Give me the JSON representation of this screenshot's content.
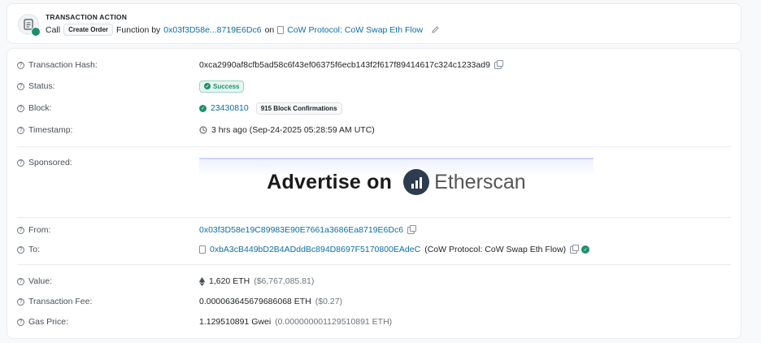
{
  "action": {
    "title": "TRANSACTION ACTION",
    "call": "Call",
    "method_pill": "Create Order",
    "function_by": "Function by",
    "from_address": "0x03f3D58e...8719E6Dc6",
    "on": "on",
    "contract": "CoW Protocol: CoW Swap Eth Flow"
  },
  "details": {
    "tx_hash_label": "Transaction Hash:",
    "tx_hash": "0xca2990af8cfb5ad58c6f43ef06375f6ecb143f2f617f89414617c324c1233ad9",
    "status_label": "Status:",
    "status": "Success",
    "block_label": "Block:",
    "block": "23430810",
    "confirmations": "915 Block Confirmations",
    "timestamp_label": "Timestamp:",
    "timestamp": "3 hrs ago (Sep-24-2025 05:28:59 AM UTC)",
    "sponsored_label": "Sponsored:",
    "ad_text": "Advertise on",
    "ad_brand": "Etherscan",
    "from_label": "From:",
    "from": "0x03f3D58e19C89983E90E7661a3686Ea8719E6Dc6",
    "to_label": "To:",
    "to": "0xbA3cB449bD2B4ADddBc894D8697F5170800EAdeC",
    "to_name": "(CoW Protocol: CoW Swap Eth Flow)",
    "value_label": "Value:",
    "value": "1,620 ETH",
    "value_usd": "($6,767,085.81)",
    "fee_label": "Transaction Fee:",
    "fee": "0.000063645679686068 ETH",
    "fee_usd": "($0.27)",
    "gas_label": "Gas Price:",
    "gas": "1.129510891 Gwei",
    "gas_eth": "(0.000000001129510891 ETH)"
  },
  "colors": {
    "accent": "#0d6ea8",
    "success": "#1e8f6c"
  }
}
